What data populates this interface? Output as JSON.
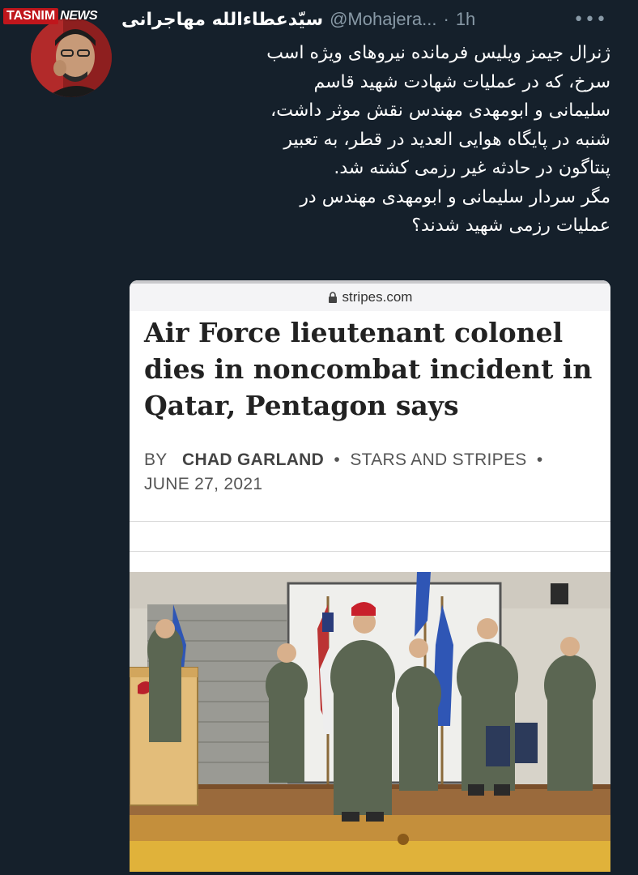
{
  "watermark": {
    "part1": "TASNIM",
    "part2": "NEWS"
  },
  "tweet": {
    "display_name": "سیّدعطاءالله مهاجرانی",
    "handle": "@Mohajera...",
    "separator": "·",
    "time": "1h",
    "more": "•••",
    "text_lines": [
      "ژنرال جیمز ویلیس فرمانده نیروهای ویژه اسب",
      "سرخ، که در عملیات شهادت شهید قاسم",
      "سلیمانی و ابومهدی مهندس نقش موثر داشت،",
      "شنبه در پایگاه هوایی العدید در قطر، به تعبیر",
      "پنتاگون در حادثه غیر رزمی کشته شد.",
      "مگر سردار سلیمانی و ابومهدی مهندس در",
      "عملیات رزمی شهید شدند؟"
    ]
  },
  "card": {
    "url": "stripes.com",
    "headline": "Air Force lieutenant colonel dies in noncombat incident in Qatar, Pentagon says",
    "by": "BY",
    "author": "CHAD GARLAND",
    "bullet": "•",
    "publication": "STARS AND STRIPES",
    "date": "JUNE 27, 2021"
  },
  "icons": {
    "lock": "lock-icon",
    "more": "more-icon"
  },
  "colors": {
    "background": "#15202b",
    "secondary_text": "#8899a6",
    "tasnim_red": "#c0161c"
  }
}
